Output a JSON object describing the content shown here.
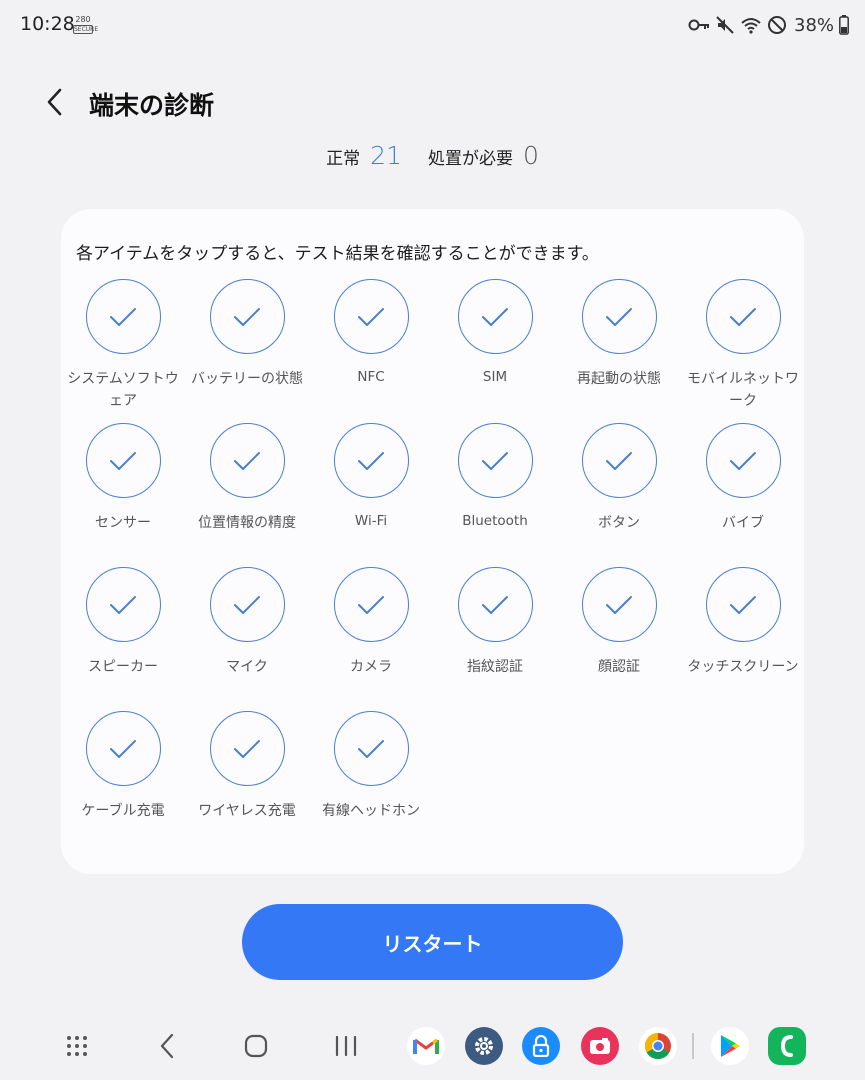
{
  "status_bar": {
    "time": "10:28",
    "badge_top": "280",
    "badge_bottom": "SECURE",
    "battery": "38%"
  },
  "header": {
    "back_icon": "chevron-left-icon",
    "title": "端末の診断"
  },
  "summary": {
    "normal_label": "正常",
    "normal_count": "21",
    "action_label": "処置が必要",
    "action_count": "0"
  },
  "card": {
    "hint": "各アイテムをタップすると、テスト結果を確認することができます。",
    "items": [
      {
        "label": "システムソフトウェア",
        "status": "ok"
      },
      {
        "label": "バッテリーの状態",
        "status": "ok"
      },
      {
        "label": "NFC",
        "status": "ok"
      },
      {
        "label": "SIM",
        "status": "ok"
      },
      {
        "label": "再起動の状態",
        "status": "ok"
      },
      {
        "label": "モバイルネットワーク",
        "status": "ok"
      },
      {
        "label": "センサー",
        "status": "ok"
      },
      {
        "label": "位置情報の精度",
        "status": "ok"
      },
      {
        "label": "Wi-Fi",
        "status": "ok"
      },
      {
        "label": "Bluetooth",
        "status": "ok"
      },
      {
        "label": "ボタン",
        "status": "ok"
      },
      {
        "label": "バイブ",
        "status": "ok"
      },
      {
        "label": "スピーカー",
        "status": "ok"
      },
      {
        "label": "マイク",
        "status": "ok"
      },
      {
        "label": "カメラ",
        "status": "ok"
      },
      {
        "label": "指紋認証",
        "status": "ok"
      },
      {
        "label": "顔認証",
        "status": "ok"
      },
      {
        "label": "タッチスクリーン",
        "status": "ok"
      },
      {
        "label": "ケーブル充電",
        "status": "ok"
      },
      {
        "label": "ワイヤレス充電",
        "status": "ok"
      },
      {
        "label": "有線ヘッドホン",
        "status": "ok"
      }
    ]
  },
  "restart_label": "リスタート",
  "colors": {
    "accent": "#3478f6",
    "check": "#4a7fcd",
    "background": "#f2f2f4",
    "card": "#fcfcfe"
  }
}
